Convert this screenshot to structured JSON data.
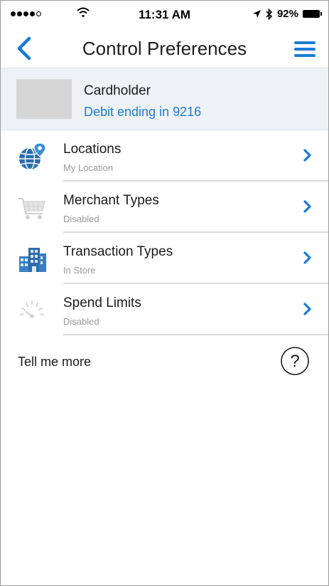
{
  "status_bar": {
    "time": "11:31 AM",
    "battery": "92%"
  },
  "nav": {
    "title": "Control Preferences"
  },
  "card": {
    "name": "Cardholder",
    "description": "Debit ending in 9216"
  },
  "items": [
    {
      "title": "Locations",
      "subtitle": "My Location",
      "icon": "globe-pin-icon"
    },
    {
      "title": "Merchant Types",
      "subtitle": "Disabled",
      "icon": "shopping-cart-icon"
    },
    {
      "title": "Transaction Types",
      "subtitle": "In Store",
      "icon": "building-icon"
    },
    {
      "title": "Spend Limits",
      "subtitle": "Disabled",
      "icon": "gauge-icon"
    }
  ],
  "footer": {
    "tell_me_more": "Tell me more",
    "help_icon_glyph": "?"
  },
  "colors": {
    "accent": "#1a7bd8",
    "header_bg": "#eef2f6",
    "subtitle": "#999999"
  }
}
